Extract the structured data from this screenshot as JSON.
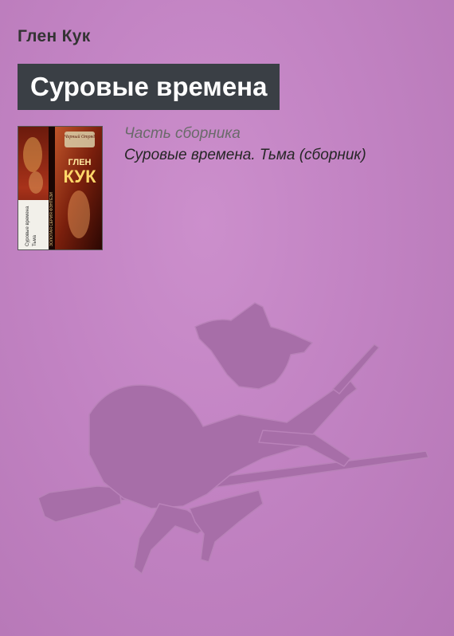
{
  "book": {
    "author": "Глен Кук",
    "title": "Суровые времена"
  },
  "collection": {
    "label": "Часть сборника",
    "link_text": "Суровые времена. Тьма (сборник)"
  },
  "cover": {
    "series": "Черный Отряд",
    "author_word": "ГЛЕН",
    "author_word2": "КУК",
    "spine_text": "ЗОЛОТАЯ СЕРИЯ ФЭНТЕЗИ",
    "titles_line1": "Суровые времена",
    "titles_line2": "Тьма"
  },
  "colors": {
    "background": "#c283c3",
    "title_box": "#3a3f45",
    "silhouette": "#a36aa3"
  },
  "icons": {
    "decoration": "witch-on-broom-silhouette"
  }
}
